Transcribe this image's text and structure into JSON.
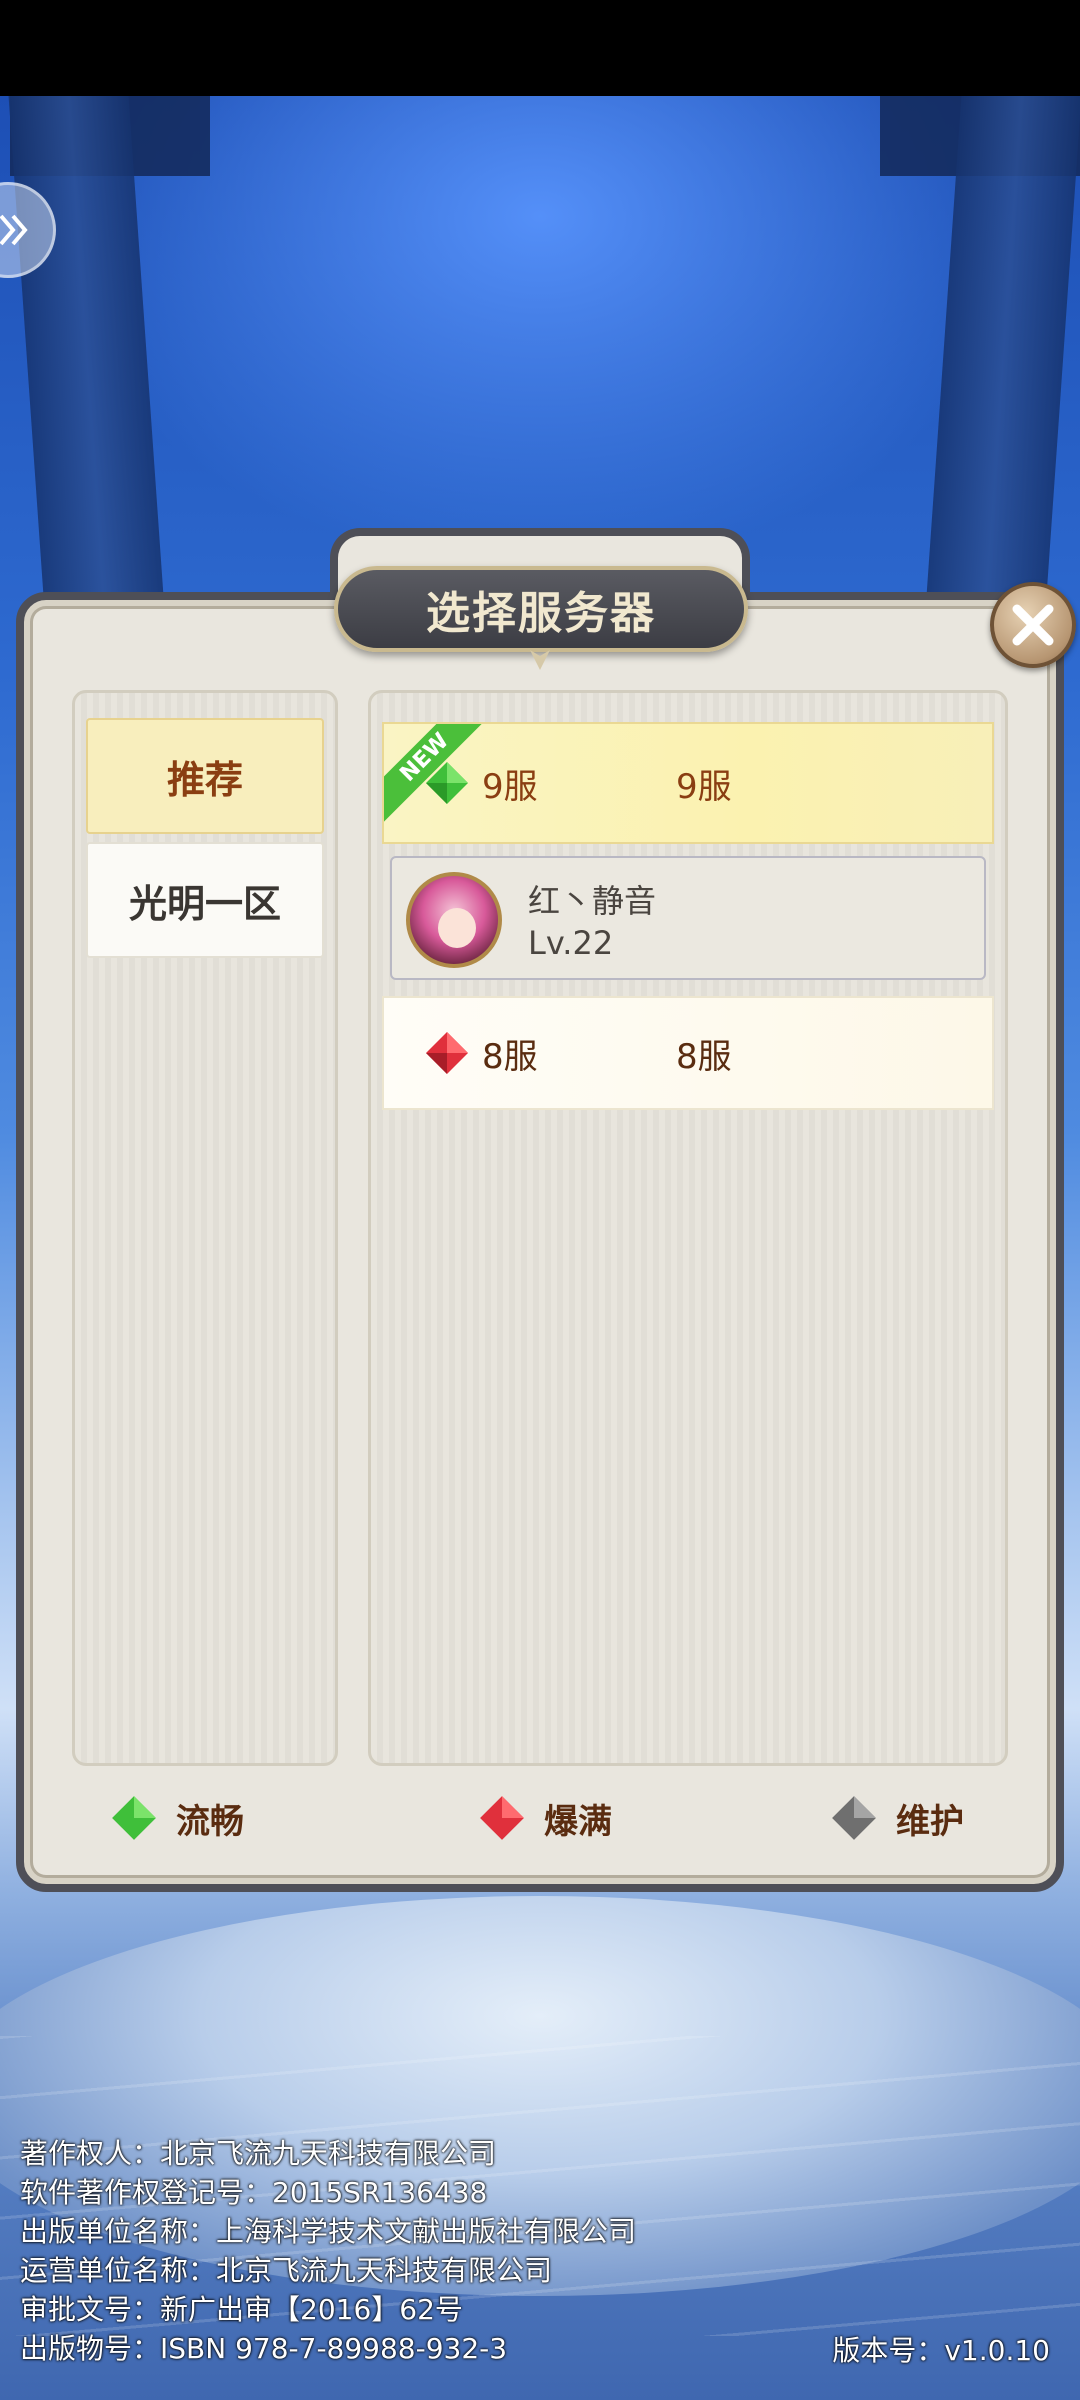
{
  "dialog": {
    "title": "选择服务器"
  },
  "tabs": [
    {
      "label": "推荐"
    },
    {
      "label": "光明一区"
    }
  ],
  "servers": [
    {
      "badge": "NEW",
      "status": "流畅",
      "status_color": "#3fbf3a",
      "name": "9服",
      "name2": "9服"
    },
    {
      "status": "爆满",
      "status_color": "#e0303c",
      "name": "8服",
      "name2": "8服"
    }
  ],
  "character": {
    "name": "红丶静音",
    "level": "Lv.22"
  },
  "legend": [
    {
      "label": "流畅",
      "color": "#3fbf3a"
    },
    {
      "label": "爆满",
      "color": "#e0303c"
    },
    {
      "label": "维护",
      "color": "#707070"
    }
  ],
  "footer": {
    "lines": [
      "著作权人：北京飞流九天科技有限公司",
      "软件著作权登记号：2015SR136438",
      "出版单位名称：上海科学技术文献出版社有限公司",
      "运营单位名称：北京飞流九天科技有限公司",
      "审批文号：新广出审【2016】62号",
      "出版物号：ISBN 978-7-89988-932-3"
    ],
    "version": "版本号：v1.0.10"
  }
}
